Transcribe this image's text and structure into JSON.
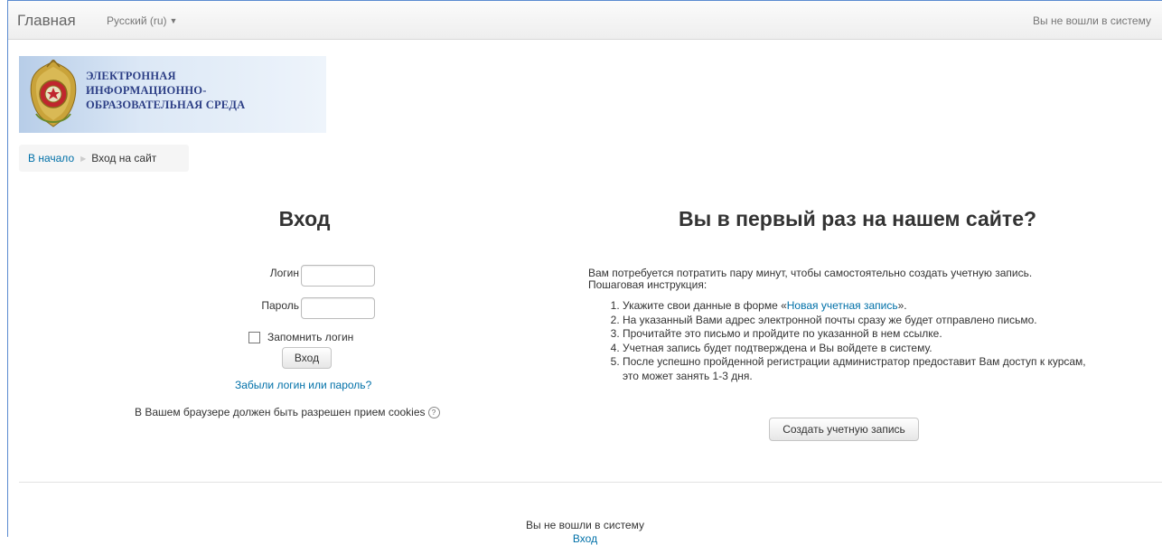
{
  "navbar": {
    "brand": "Главная",
    "language": "Русский (ru)",
    "login_status": "Вы не вошли в систему"
  },
  "logo": {
    "lines": [
      "ЭЛЕКТРОННАЯ",
      "ИНФОРМАЦИОННО-",
      "ОБРАЗОВАТЕЛЬНАЯ СРЕДА"
    ]
  },
  "breadcrumb": {
    "home": "В начало",
    "current": "Вход на сайт"
  },
  "login": {
    "title": "Вход",
    "username_label": "Логин",
    "username_value": "",
    "password_label": "Пароль",
    "password_value": "",
    "remember_label": "Запомнить логин",
    "remember_checked": false,
    "submit_label": "Вход",
    "forgot_link": "Забыли логин или пароль?",
    "cookies_note": "В Вашем браузере должен быть разрешен прием cookies"
  },
  "signup": {
    "title": "Вы в первый раз на нашем сайте?",
    "intro_1": "Вам потребуется потратить пару минут, чтобы самостоятельно создать учетную запись.",
    "intro_2": "Пошаговая инструкция:",
    "step1_before": "Укажите свои данные в форме «",
    "step1_link": "Новая учетная запись",
    "step1_after": "».",
    "step2": "На указанный Вами адрес электронной почты сразу же будет отправлено письмо.",
    "step3": "Прочитайте это письмо и пройдите по указанной в нем ссылке.",
    "step4": "Учетная запись будет подтверждена и Вы войдете в систему.",
    "step5": "После успешно пройденной регистрации администратор предоставит Вам доступ к курсам, это может занять 1-3 дня.",
    "button_label": "Создать учетную запись"
  },
  "footer": {
    "login_status": "Вы не вошли в систему",
    "login_link": "Вход"
  },
  "colors": {
    "link": "#0070a8",
    "logo_text": "#2d3f86",
    "frame_border": "#5b8bd0"
  }
}
